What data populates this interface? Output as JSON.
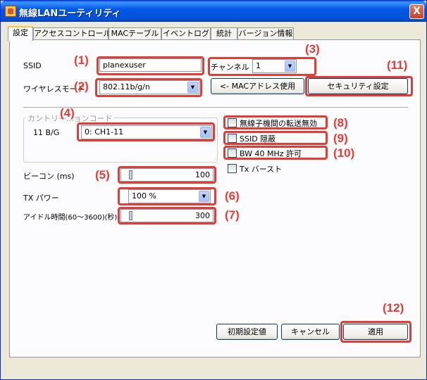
{
  "window": {
    "title": "無線LANユーティリティ",
    "close_glyph": "X"
  },
  "tabs": [
    {
      "label": "設定"
    },
    {
      "label": "アクセスコントロール"
    },
    {
      "label": "MACテーブル"
    },
    {
      "label": "イベントログ"
    },
    {
      "label": "統計"
    },
    {
      "label": "バージョン情報"
    }
  ],
  "form": {
    "ssid_label": "SSID",
    "ssid_value": "planexuser",
    "channel_label": "チャンネル",
    "channel_value": "1",
    "wireless_mode_label": "ワイヤレスモード",
    "wireless_mode_value": "802.11b/g/n",
    "mac_address_button": "<- MACアドレス使用",
    "security_button": "セキュリティ設定",
    "country_group_label": "カントリー...ョンコード",
    "country_band_label": "11 B/G",
    "country_value": "0: CH1-11",
    "beacon_label": "ビーコン (ms)",
    "beacon_value": "100",
    "tx_power_label": "TX パワー",
    "tx_power_value": "100 %",
    "idle_time_label": "アイドル時間(60～3600)(秒)",
    "idle_time_value": "300"
  },
  "checkboxes": {
    "isolation": "無線子機間の転送無効",
    "ssid_hide": "SSID 隠蔽",
    "bw40": "BW 40 MHz 許可",
    "tx_burst": "Tx バースト"
  },
  "buttons": {
    "defaults": "初期設定値",
    "cancel": "キャンセル",
    "apply": "適用"
  },
  "callouts": {
    "c1": "(1)",
    "c2": "(2)",
    "c3": "(3)",
    "c4": "(4)",
    "c5": "(5)",
    "c6": "(6)",
    "c7": "(7)",
    "c8": "(8)",
    "c9": "(9)",
    "c10": "(10)",
    "c11": "(11)",
    "c12": "(12)"
  },
  "colors": {
    "annotation": "#e23c35",
    "titlebar": "#0058e6",
    "tab_highlight": "#ffc83c"
  }
}
